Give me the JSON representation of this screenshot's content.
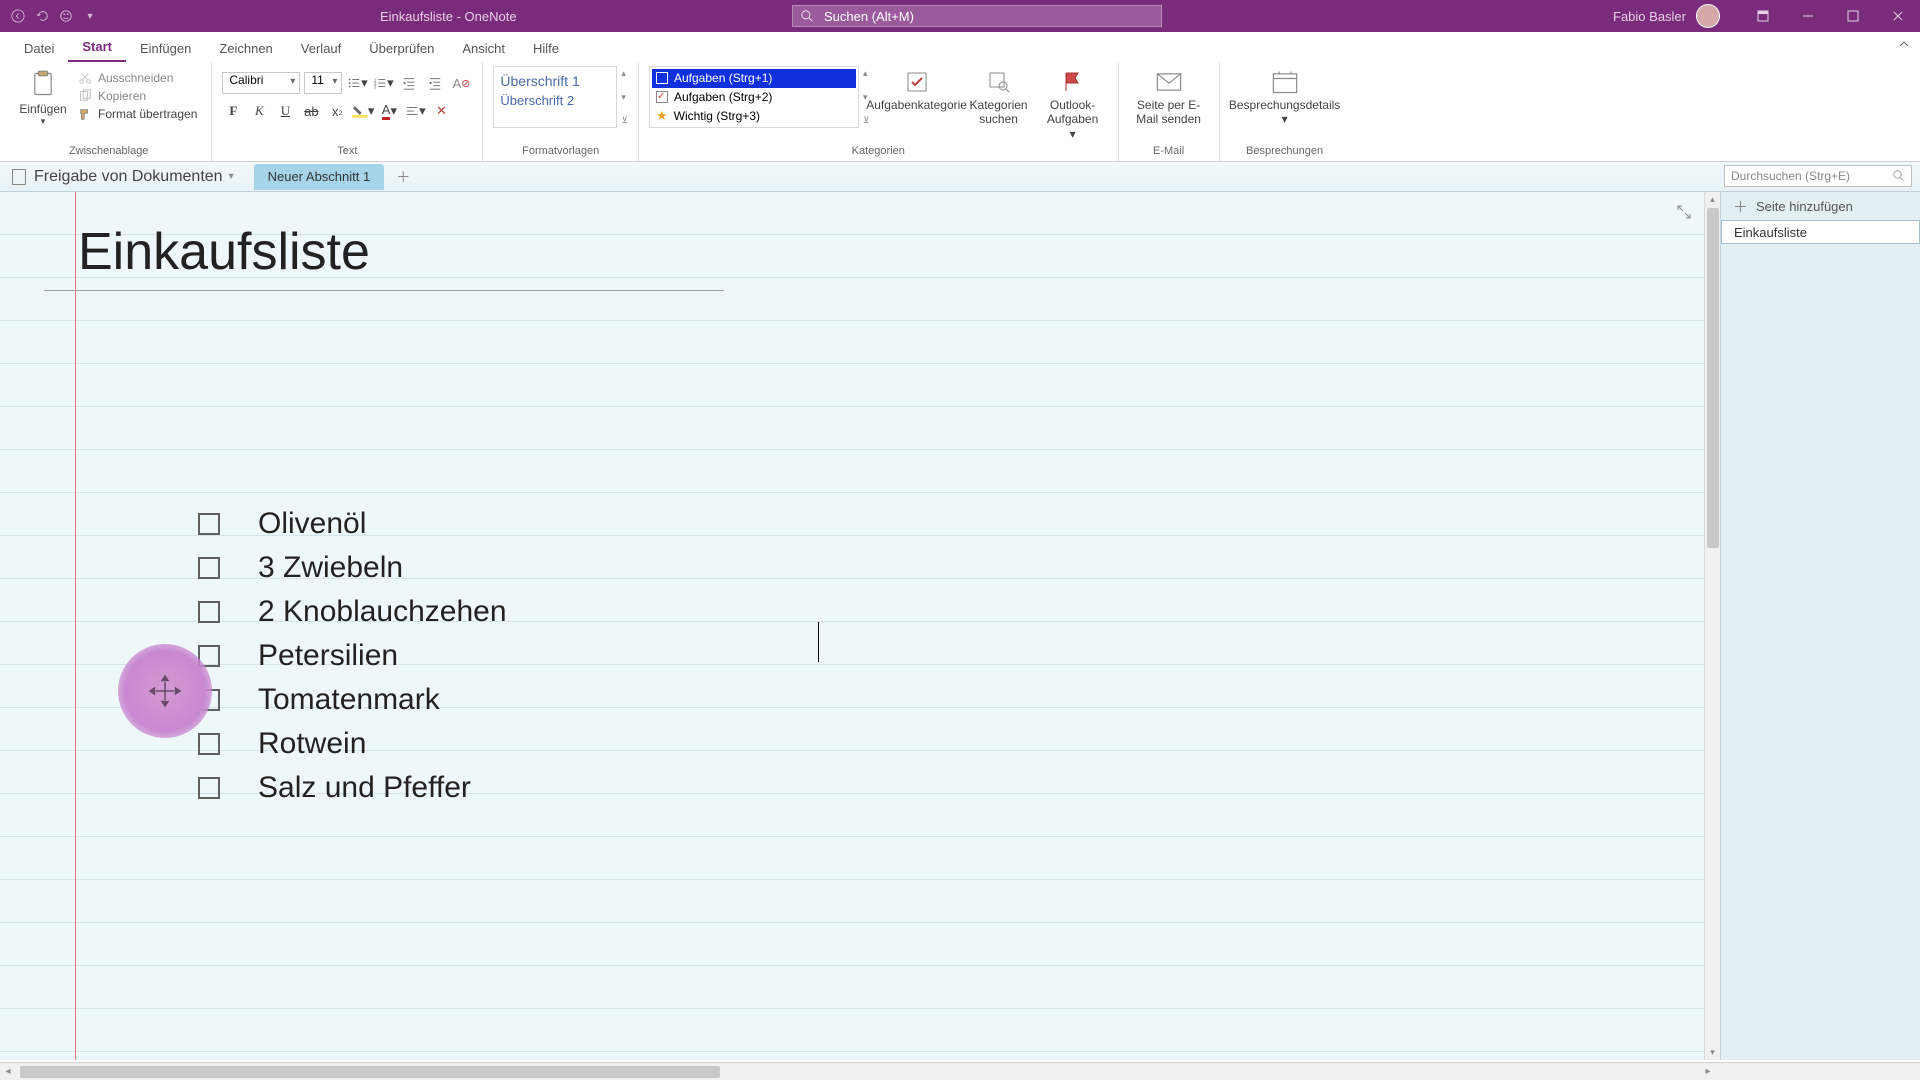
{
  "titlebar": {
    "doc_title": "Einkaufsliste  -  OneNote",
    "search_placeholder": "Suchen (Alt+M)",
    "username": "Fabio Basler"
  },
  "ribbon_tabs": [
    "Datei",
    "Start",
    "Einfügen",
    "Zeichnen",
    "Verlauf",
    "Überprüfen",
    "Ansicht",
    "Hilfe"
  ],
  "ribbon_active_index": 1,
  "ribbon": {
    "clipboard": {
      "paste": "Einfügen",
      "cut": "Ausschneiden",
      "copy": "Kopieren",
      "format_painter": "Format übertragen",
      "label": "Zwischenablage"
    },
    "font": {
      "name": "Calibri",
      "size": "11",
      "label": "Text"
    },
    "styles": {
      "h1": "Überschrift 1",
      "h2": "Überschrift 2",
      "label": "Formatvorlagen"
    },
    "tags": {
      "item1": "Aufgaben (Strg+1)",
      "item2": "Aufgaben (Strg+2)",
      "item3": "Wichtig (Strg+3)",
      "task_category": "Aufgabenkategorie",
      "find_tags": "Kategorien suchen",
      "outlook_tasks": "Outlook-Aufgaben",
      "label": "Kategorien"
    },
    "email": {
      "send": "Seite per E-Mail senden",
      "label": "E-Mail"
    },
    "meetings": {
      "details": "Besprechungsdetails",
      "label": "Besprechungen"
    }
  },
  "notebook": {
    "name": "Freigabe von Dokumenten",
    "section": "Neuer Abschnitt 1",
    "search": "Durchsuchen (Strg+E)"
  },
  "page_panel": {
    "add_page": "Seite hinzufügen",
    "pages": [
      "Einkaufsliste"
    ]
  },
  "page": {
    "title": "Einkaufsliste",
    "items": [
      "Olivenöl",
      "3 Zwiebeln",
      "2 Knoblauchzehen",
      "Petersilien",
      "Tomatenmark",
      "Rotwein",
      "Salz und Pfeffer"
    ]
  }
}
